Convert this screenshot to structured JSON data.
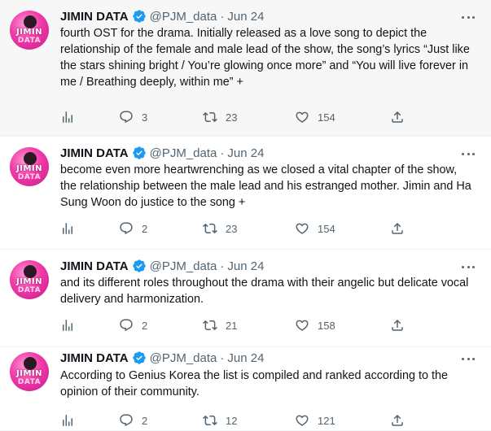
{
  "tweets": [
    {
      "author": "JIMIN DATA",
      "handle": "@PJM_data",
      "separator": "·",
      "date": "Jun 24",
      "avatar_text_1": "JIMIN",
      "avatar_text_2": "DATA",
      "text": "fourth OST for the drama. Initially released as a love song to depict the relationship of the female and male lead of the show, the song’s lyrics “Just like the stars shining bright / You’re glowing once more” and “You will live forever in me / Breathing deeply, within me” +",
      "replies": "3",
      "retweets": "23",
      "likes": "154"
    },
    {
      "author": "JIMIN DATA",
      "handle": "@PJM_data",
      "separator": "·",
      "date": "Jun 24",
      "avatar_text_1": "JIMIN",
      "avatar_text_2": "DATA",
      "text": "become even more heartwrenching as we closed a vital chapter of the show, the relationship between the male lead and his estranged mother. Jimin and Ha Sung Woon do justice to the song +",
      "replies": "2",
      "retweets": "23",
      "likes": "154"
    },
    {
      "author": "JIMIN DATA",
      "handle": "@PJM_data",
      "separator": "·",
      "date": "Jun 24",
      "avatar_text_1": "JIMIN",
      "avatar_text_2": "DATA",
      "text": "and its different roles throughout the drama with their angelic but delicate vocal delivery and harmonization.",
      "replies": "2",
      "retweets": "21",
      "likes": "158"
    },
    {
      "author": "JIMIN DATA",
      "handle": "@PJM_data",
      "separator": "·",
      "date": "Jun 24",
      "avatar_text_1": "JIMIN",
      "avatar_text_2": "DATA",
      "text": "According to Genius Korea the list is compiled and ranked according to the opinion of their community.",
      "replies": "2",
      "retweets": "12",
      "likes": "121"
    }
  ],
  "colors": {
    "verified": "#1d9bf0",
    "muted_text": "#536471",
    "primary_text": "#0f1419",
    "avatar_pink": "#f03ca8",
    "highlight_bg": "#f7f7f7"
  },
  "icons": [
    "views-icon",
    "reply-icon",
    "retweet-icon",
    "like-icon",
    "share-icon",
    "more-icon",
    "verified-badge-icon"
  ]
}
